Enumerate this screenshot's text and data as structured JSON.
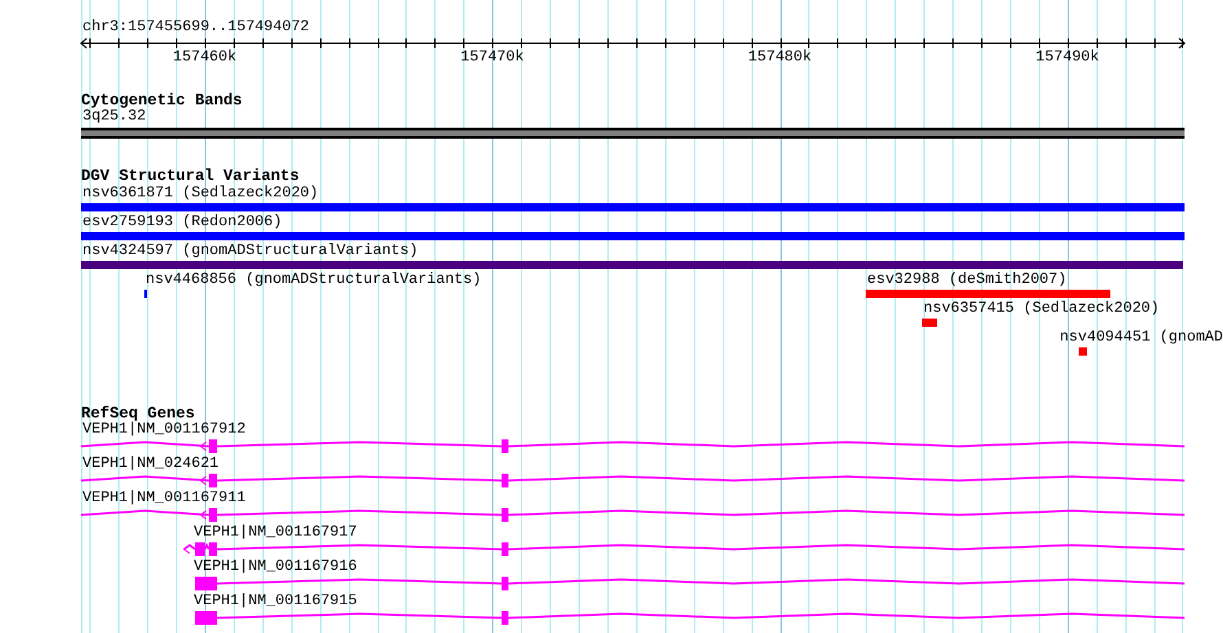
{
  "ruler": {
    "location": "chr3:157455699..157494072",
    "ticks": [
      "157460k",
      "157470k",
      "157480k",
      "157490k"
    ]
  },
  "tracks": [
    {
      "title": "Cytogenetic Bands",
      "kind": "bands",
      "features": [
        {
          "label": "3q25.32"
        }
      ]
    },
    {
      "title": "DGV Structural Variants",
      "kind": "variants",
      "features": [
        {
          "label": "nsv6361871 (Sedlazeck2020)",
          "color": "#0000ff"
        },
        {
          "label": "esv2759193 (Redon2006)",
          "color": "#0000ff"
        },
        {
          "label": "nsv4324597 (gnomADStructuralVariants)",
          "color": "#4b0082"
        },
        {
          "label": "nsv4468856 (gnomADStructuralVariants)",
          "color": "#0000ff"
        },
        {
          "label": "esv32988 (deSmith2007)",
          "color": "#ff0000"
        },
        {
          "label": "nsv6357415 (Sedlazeck2020)",
          "color": "#ff0000"
        },
        {
          "label": "nsv4094451 (gnomAD",
          "color": "#ff0000"
        }
      ]
    },
    {
      "title": "RefSeq Genes",
      "kind": "genes",
      "features": [
        {
          "label": "VEPH1|NM_001167912"
        },
        {
          "label": "VEPH1|NM_024621"
        },
        {
          "label": "VEPH1|NM_001167911"
        },
        {
          "label": "VEPH1|NM_001167917"
        },
        {
          "label": "VEPH1|NM_001167916"
        },
        {
          "label": "VEPH1|NM_001167915"
        }
      ]
    }
  ]
}
